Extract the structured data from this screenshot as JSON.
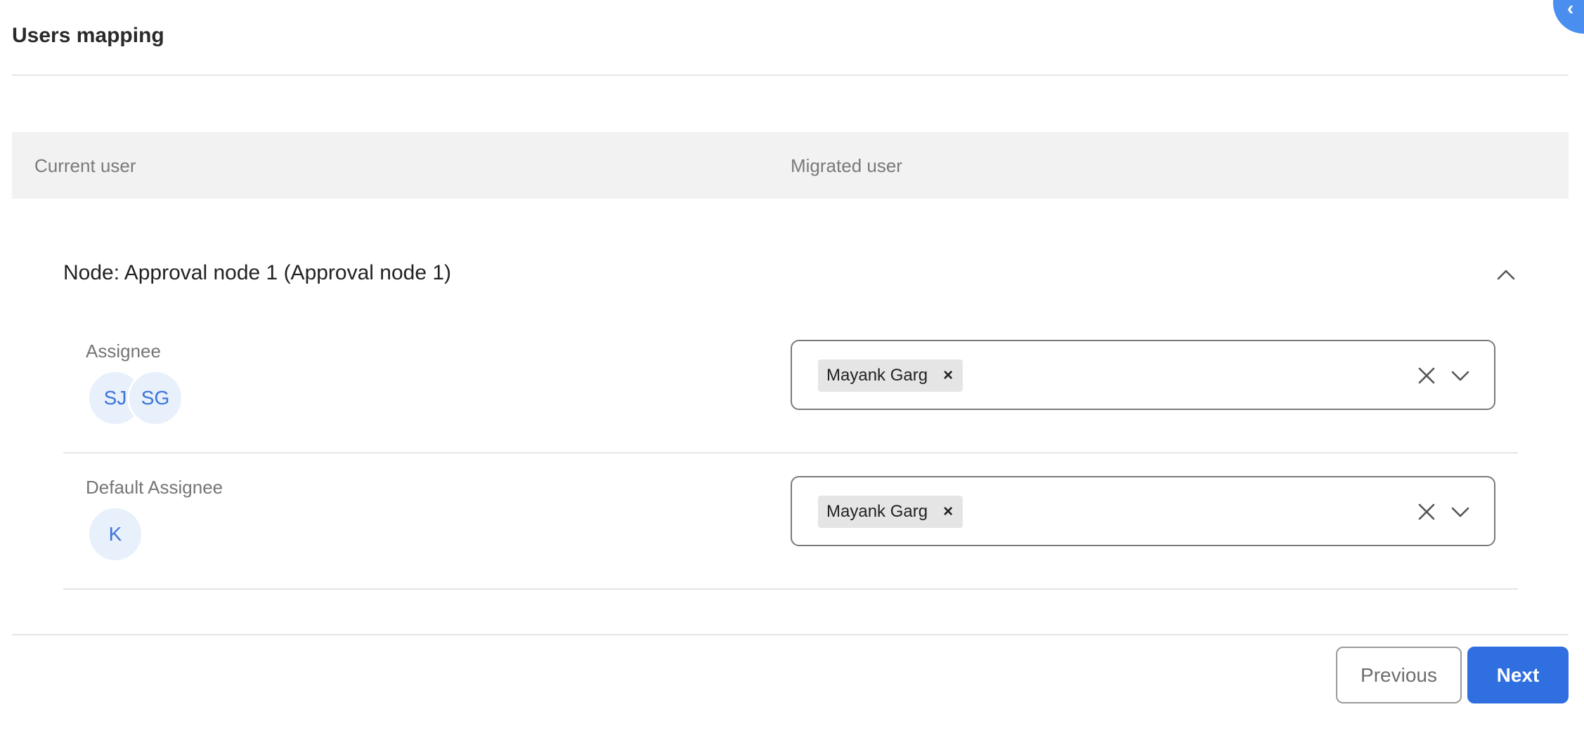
{
  "page": {
    "title": "Users mapping"
  },
  "table_header": {
    "current_user": "Current user",
    "migrated_user": "Migrated user"
  },
  "node": {
    "title": "Node: Approval node 1 (Approval node 1)",
    "expanded": true,
    "rows": [
      {
        "label": "Assignee",
        "current_avatars": [
          "SJ",
          "SG"
        ],
        "migrated_users": [
          "Mayank Garg"
        ]
      },
      {
        "label": "Default Assignee",
        "current_avatars": [
          "K"
        ],
        "migrated_users": [
          "Mayank Garg"
        ]
      }
    ]
  },
  "chip_remove_glyph": "×",
  "footer": {
    "previous_label": "Previous",
    "next_label": "Next"
  },
  "colors": {
    "primary": "#2f6fe0",
    "avatar_bg": "#e8f0fc",
    "avatar_text": "#3a74d8",
    "header_bg": "#f2f2f2",
    "chip_bg": "#e5e5e5"
  },
  "icons": {
    "collapse": "chevron-up-icon",
    "clear": "close-icon",
    "dropdown": "chevron-down-icon"
  }
}
